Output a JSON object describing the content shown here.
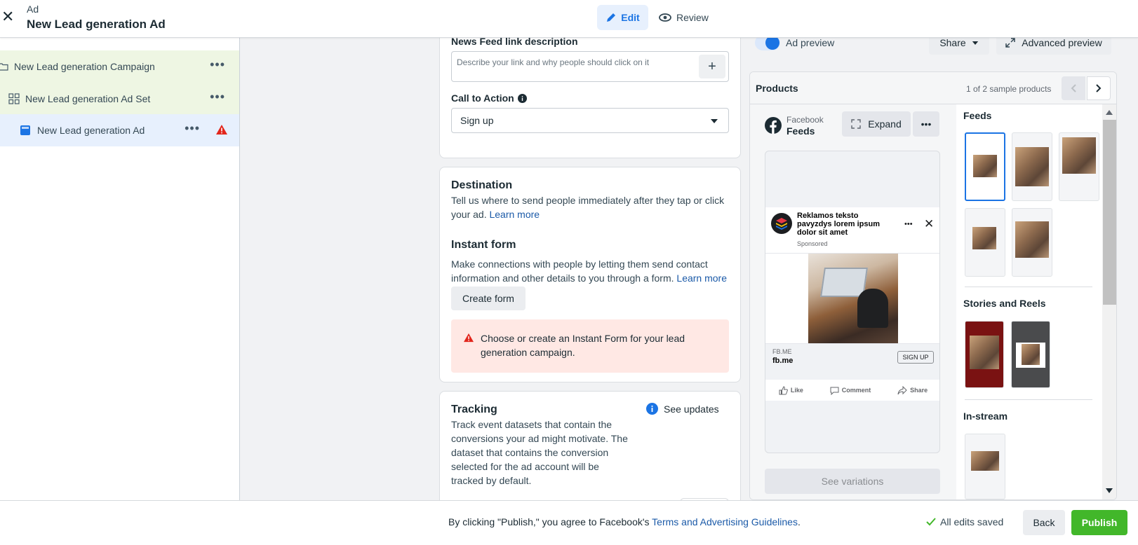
{
  "header": {
    "type_label": "Ad",
    "title": "New Lead generation Ad",
    "tab_edit": "Edit",
    "tab_review": "Review"
  },
  "sidebar": {
    "items": [
      {
        "label": "New Lead generation Campaign"
      },
      {
        "label": "New Lead generation Ad Set"
      },
      {
        "label": "New Lead generation Ad"
      }
    ]
  },
  "editor": {
    "news_feed_label": "News Feed link description",
    "news_feed_placeholder": "Describe your link and why people should click on it",
    "cta_label": "Call to Action",
    "cta_value": "Sign up",
    "destination_title": "Destination",
    "destination_desc": "Tell us where to send people immediately after they tap or click your ad.",
    "learn_more": "Learn more",
    "instant_form_title": "Instant form",
    "instant_form_desc": "Make connections with people by letting them send contact information and other details to you through a form.",
    "create_form": "Create form",
    "error_text": "Choose or create an Instant Form for your lead generation campaign.",
    "tracking_title": "Tracking",
    "tracking_desc": "Track event datasets that contain the conversions your ad might motivate. The dataset that contains the conversion selected for the ad account will be tracked by default.",
    "see_updates": "See updates"
  },
  "preview": {
    "toggle_label": "Ad preview",
    "share": "Share",
    "advanced_preview": "Advanced preview",
    "products_title": "Products",
    "sample_count": "1 of 2 sample products",
    "platform": "Facebook",
    "placement": "Feeds",
    "expand": "Expand",
    "post_text": "Reklamos teksto pavyzdys lorem ipsum dolor sit amet",
    "sponsored": "Sponsored",
    "link_domain_caps": "FB.ME",
    "link_domain": "fb.me",
    "cta_button": "SIGN UP",
    "like": "Like",
    "comment": "Comment",
    "share_action": "Share",
    "see_variations": "See variations",
    "sections": {
      "feeds": "Feeds",
      "stories": "Stories and Reels",
      "instream": "In-stream"
    }
  },
  "footer": {
    "publish_agree_prefix": "By clicking \"Publish,\" you agree to Facebook's ",
    "terms_link": "Terms and Advertising Guidelines",
    "period": ".",
    "saved_status": "All edits saved",
    "back": "Back",
    "publish": "Publish"
  },
  "colors": {
    "accent": "#1b74e4",
    "publish_green": "#42b72a",
    "error_bg": "#ffe8e4",
    "error_red": "#e2261c",
    "campaign_bg": "#eef6e3",
    "selected_bg": "#e7f0fd"
  }
}
